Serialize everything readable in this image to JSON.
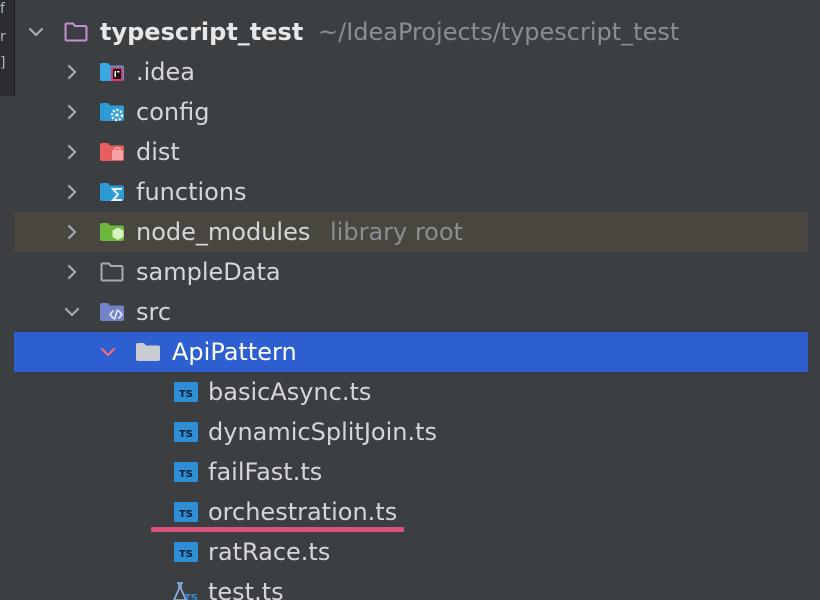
{
  "colors": {
    "background": "#3c3f41",
    "selection": "#2e5fd1",
    "library_row": "#49463f",
    "annotation_underline": "#d9537d",
    "hint_text": "#8b8d91"
  },
  "project": {
    "name": "typescript_test",
    "path": "~/IdeaProjects/typescript_test",
    "icon": "folder-outline-icon"
  },
  "tree": {
    "idea": {
      "label": ".idea",
      "icon": "idea-folder-icon"
    },
    "config": {
      "label": "config",
      "icon": "config-folder-icon"
    },
    "dist": {
      "label": "dist",
      "icon": "dist-folder-icon"
    },
    "functions": {
      "label": "functions",
      "icon": "functions-folder-icon"
    },
    "node_modules": {
      "label": "node_modules",
      "hint": "library root",
      "icon": "node-modules-folder-icon"
    },
    "sampleData": {
      "label": "sampleData",
      "icon": "folder-outline-icon"
    },
    "src": {
      "label": "src",
      "icon": "source-folder-icon"
    },
    "apiPattern": {
      "label": "ApiPattern",
      "icon": "folder-icon"
    },
    "files": [
      {
        "label": "basicAsync.ts",
        "icon": "typescript-file-icon",
        "badge": "TS"
      },
      {
        "label": "dynamicSplitJoin.ts",
        "icon": "typescript-file-icon",
        "badge": "TS"
      },
      {
        "label": "failFast.ts",
        "icon": "typescript-file-icon",
        "badge": "TS"
      },
      {
        "label": "orchestration.ts",
        "icon": "typescript-file-icon",
        "badge": "TS"
      },
      {
        "label": "ratRace.ts",
        "icon": "typescript-file-icon",
        "badge": "TS"
      },
      {
        "label": "test.ts",
        "icon": "typescript-test-file-icon",
        "badge": "TS"
      }
    ]
  }
}
